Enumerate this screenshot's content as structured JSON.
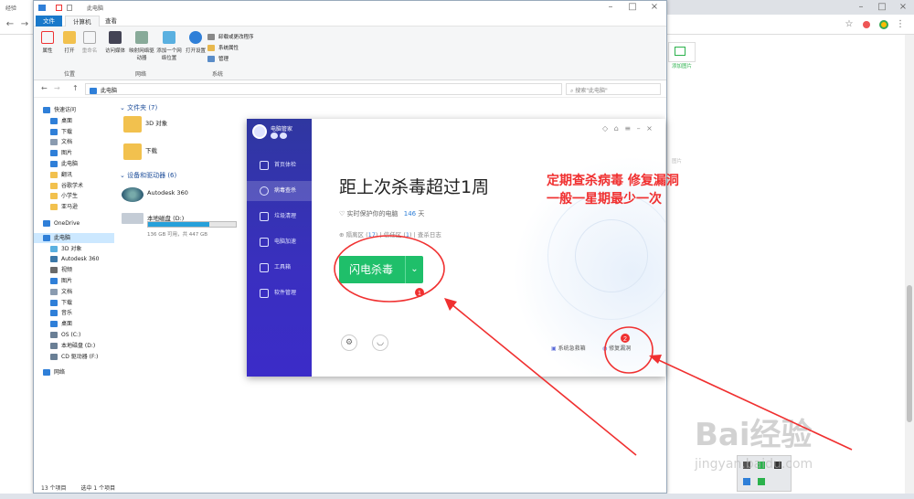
{
  "browser": {
    "tab_label": "经验",
    "right_panel_link": "添加图片",
    "right_panel_text": "图片"
  },
  "explorer": {
    "title": "此电脑",
    "ribbon_tabs": [
      "文件",
      "计算机",
      "查看"
    ],
    "ribbon": {
      "properties": "属性",
      "open": "打开",
      "rename": "重命名",
      "media": "访问媒体",
      "map_drive": "映射网络驱动器",
      "add_location": "添加一个网络位置",
      "open_settings": "打开设置",
      "uninstall": "卸载或更改程序",
      "sys_props": "系统属性",
      "manage": "管理",
      "group_location": "位置",
      "group_network": "网络",
      "group_system": "系统"
    },
    "path": "此电脑",
    "search_placeholder": "搜索\"此电脑\"",
    "sidebar": [
      {
        "label": "快速访问",
        "color": "#2f7fd8"
      },
      {
        "label": "桌面",
        "color": "#2f7fd8"
      },
      {
        "label": "下载",
        "color": "#2f7fd8"
      },
      {
        "label": "文档",
        "color": "#8a9bb0"
      },
      {
        "label": "图片",
        "color": "#2f7fd8"
      },
      {
        "label": "此电脑",
        "color": "#2f7fd8"
      },
      {
        "label": "翻讯",
        "color": "#f2c14e"
      },
      {
        "label": "谷歌学术",
        "color": "#f2c14e"
      },
      {
        "label": "小学生",
        "color": "#f2c14e"
      },
      {
        "label": "亚马逊",
        "color": "#f2c14e"
      },
      {
        "label": "OneDrive",
        "color": "#2f7fd8"
      },
      {
        "label": "此电脑",
        "color": "#2f7fd8"
      },
      {
        "label": "3D 对象",
        "color": "#5ab0e0"
      },
      {
        "label": "Autodesk 360",
        "color": "#3b78a8"
      },
      {
        "label": "视频",
        "color": "#6a6a6a"
      },
      {
        "label": "图片",
        "color": "#2f7fd8"
      },
      {
        "label": "文档",
        "color": "#8a9bb0"
      },
      {
        "label": "下载",
        "color": "#2f7fd8"
      },
      {
        "label": "音乐",
        "color": "#2f7fd8"
      },
      {
        "label": "桌面",
        "color": "#2f7fd8"
      },
      {
        "label": "OS (C:)",
        "color": "#6a7f95"
      },
      {
        "label": "本地磁盘 (D:)",
        "color": "#6a7f95"
      },
      {
        "label": "CD 驱动器 (F:)",
        "color": "#6a7f95"
      },
      {
        "label": "网络",
        "color": "#2f7fd8"
      }
    ],
    "folders_header": "文件夹 (7)",
    "folder_3d": "3D 对象",
    "folder_download": "下载",
    "devices_header": "设备和驱动器 (6)",
    "autodesk": "Autodesk 360",
    "disk_name": "本地磁盘 (D:)",
    "disk_info": "136 GB 可用，共 447 GB",
    "disk_fill": 0.7,
    "status_count": "13 个项目",
    "status_selected": "选中 1 个项目"
  },
  "pcmanager": {
    "brand": "电脑管家",
    "nav": [
      "首页体检",
      "病毒查杀",
      "垃圾清理",
      "电脑加速",
      "工具箱",
      "软件管理"
    ],
    "title": "距上次杀毒超过1周",
    "protect_prefix": "实时保护你的电脑",
    "protect_days": "146",
    "protect_suffix": "天",
    "quarantine": "隔离区",
    "quarantine_count": "17",
    "trust": "信任区",
    "trust_count": "1",
    "log": "查杀日志",
    "scan_button": "闪电杀毒",
    "sys_rescue": "系统急救箱",
    "repair": "修复漏洞"
  },
  "annotation": {
    "line1": "定期查杀病毒 修复漏洞",
    "line2": "一般一星期最少一次",
    "badge1": "1",
    "badge2": "2"
  },
  "watermark": {
    "main": "Bai经验",
    "sub": "jingyan.baidu.com"
  }
}
